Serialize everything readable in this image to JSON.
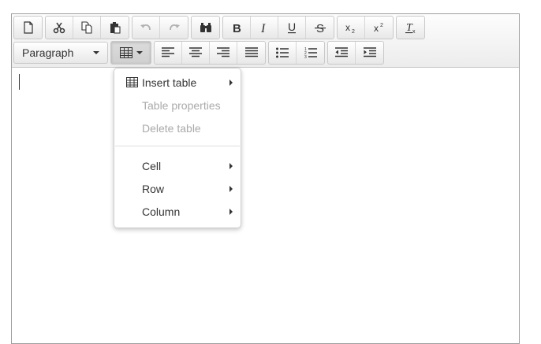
{
  "toolbar": {
    "format_select": "Paragraph",
    "icons": [
      "new-document-icon",
      "cut-icon",
      "copy-icon",
      "paste-icon",
      "undo-icon",
      "redo-icon",
      "find-icon",
      "bold-icon",
      "italic-icon",
      "underline-icon",
      "strikethrough-icon",
      "subscript-icon",
      "superscript-icon",
      "clear-formatting-icon",
      "table-icon",
      "align-left-icon",
      "align-center-icon",
      "align-right-icon",
      "justify-icon",
      "bullet-list-icon",
      "numbered-list-icon",
      "outdent-icon",
      "indent-icon"
    ]
  },
  "table_menu": {
    "items": [
      {
        "label": "Insert table",
        "enabled": true,
        "submenu": true
      },
      {
        "label": "Table properties",
        "enabled": false,
        "submenu": false
      },
      {
        "label": "Delete table",
        "enabled": false,
        "submenu": false
      },
      {
        "label": "Cell",
        "enabled": true,
        "submenu": true
      },
      {
        "label": "Row",
        "enabled": true,
        "submenu": true
      },
      {
        "label": "Column",
        "enabled": true,
        "submenu": true
      }
    ]
  }
}
